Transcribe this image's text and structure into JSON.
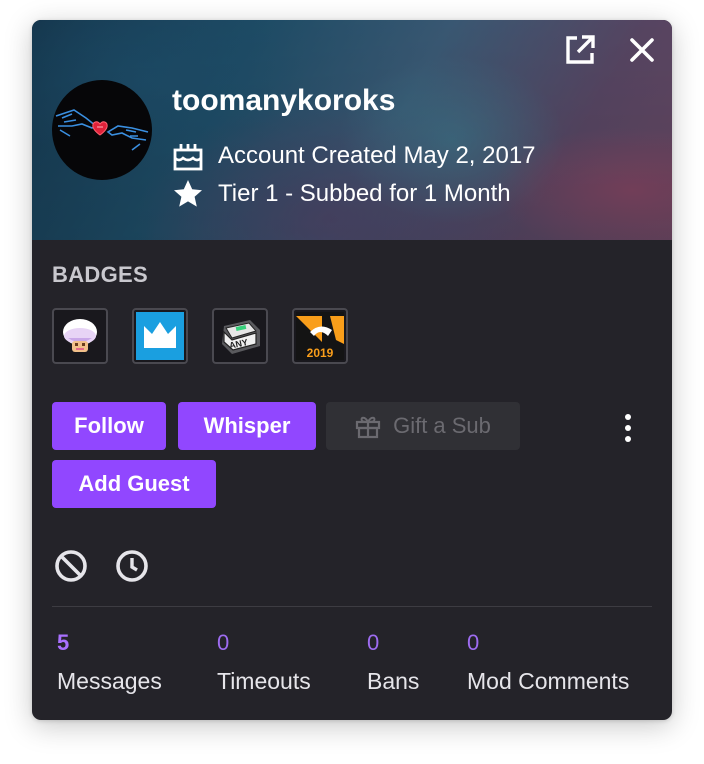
{
  "header": {
    "username": "toomanykoroks",
    "account_created": "Account Created May 2, 2017",
    "subscription": "Tier 1 - Subbed for 1 Month"
  },
  "badges": {
    "title": "BADGES",
    "items": [
      {
        "name": "mushroom-lamp-badge"
      },
      {
        "name": "crown-badge"
      },
      {
        "name": "any-key-badge"
      },
      {
        "name": "overwatch-league-2019-badge",
        "text": "2019"
      }
    ]
  },
  "actions": {
    "follow": "Follow",
    "whisper": "Whisper",
    "gift_sub": "Gift a Sub",
    "add_guest": "Add Guest"
  },
  "stats": [
    {
      "value": "5",
      "label": "Messages"
    },
    {
      "value": "0",
      "label": "Timeouts"
    },
    {
      "value": "0",
      "label": "Bans"
    },
    {
      "value": "0",
      "label": "Mod Comments"
    }
  ],
  "colors": {
    "accent": "#9147ff",
    "card_bg": "#242329",
    "stat_value": "#a970ff"
  },
  "icons": [
    "popout-icon",
    "close-icon",
    "cake-icon",
    "star-icon",
    "gift-icon",
    "more-vertical-icon",
    "ban-icon",
    "timeout-clock-icon"
  ]
}
